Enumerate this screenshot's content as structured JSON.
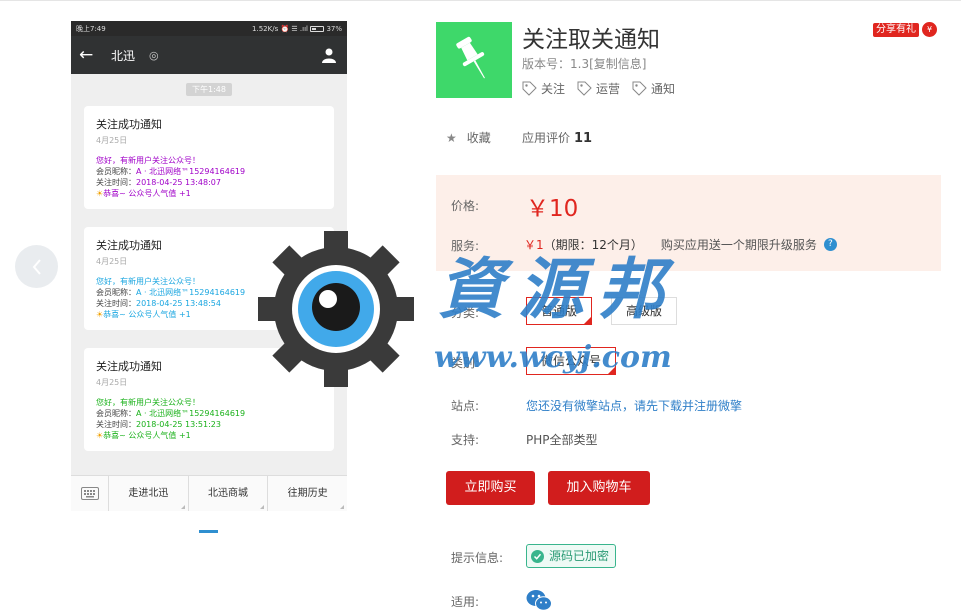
{
  "phone": {
    "status_left": "晚上7:49",
    "status_right": "1.52K/s ⏰ ☰ .ııl",
    "battery": "37%",
    "nav_title": "北迅",
    "time_chip": "下午1:48",
    "messages": [
      {
        "title": "关注成功通知",
        "date": "4月25日",
        "hello": "您好，有新用户关注公众号！",
        "nick_label": "会员昵称：",
        "nick": "A · 北迅网络™15294164619",
        "time_label": "关注时间：",
        "time": "2018-04-25 13:48:07",
        "congrats": "恭喜~  公众号人气值 +1",
        "color": "#a000c8"
      },
      {
        "title": "关注成功通知",
        "date": "4月25日",
        "hello": "您好，有新用户关注公众号！",
        "nick_label": "会员昵称：",
        "nick": "A · 北迅网络™15294164619",
        "time_label": "关注时间：",
        "time": "2018-04-25 13:48:54",
        "congrats": "恭喜~  公众号人气值 +1",
        "color": "#1aa6e0"
      },
      {
        "title": "关注成功通知",
        "date": "4月25日",
        "hello": "您好，有新用户关注公众号！",
        "nick_label": "会员昵称：",
        "nick": "A · 北迅网络™15294164619",
        "time_label": "关注时间：",
        "time": "2018-04-25 13:51:23",
        "congrats": "恭喜~  公众号人气值 +1",
        "color": "#1ab11a"
      }
    ],
    "menu": [
      "走进北迅",
      "北迅商城",
      "往期历史"
    ]
  },
  "watermark": {
    "word": "資源邦",
    "url": "www.wcyj.com"
  },
  "app": {
    "title": "关注取关通知",
    "version_label": "版本号：",
    "version": "1.3",
    "copy_info": "[复制信息]",
    "tags": [
      "关注",
      "运营",
      "通知"
    ],
    "share": "分享有礼",
    "share_icon": "¥",
    "favorite": "收藏",
    "rating_label": "应用评价",
    "rating_count": "11"
  },
  "pricing": {
    "price_label": "价格:",
    "price": "￥10",
    "service_label": "服务:",
    "service_price": "￥1",
    "service_period": "（期限：12个月）",
    "service_note": "购买应用送一个期限升级服务",
    "help": "?"
  },
  "options": {
    "category_label": "分类:",
    "category_options": [
      "普通版",
      "高级版"
    ],
    "type_label": "类别:",
    "type_options": [
      "微信公众号"
    ],
    "site_label": "站点:",
    "site_link": "您还没有微擎站点，请先下载并注册微擎",
    "support_label": "支持:",
    "support_value": "PHP全部类型"
  },
  "actions": {
    "buy": "立即购买",
    "cart": "加入购物车"
  },
  "footer": {
    "tip_label": "提示信息:",
    "encrypted": "源码已加密",
    "apply_label": "适用:"
  },
  "colors": {
    "accent": "#e0261f",
    "button": "#d11d1d",
    "app_icon": "#3ed86a",
    "link": "#2f7fc8",
    "price_bg": "#fdefe9"
  }
}
